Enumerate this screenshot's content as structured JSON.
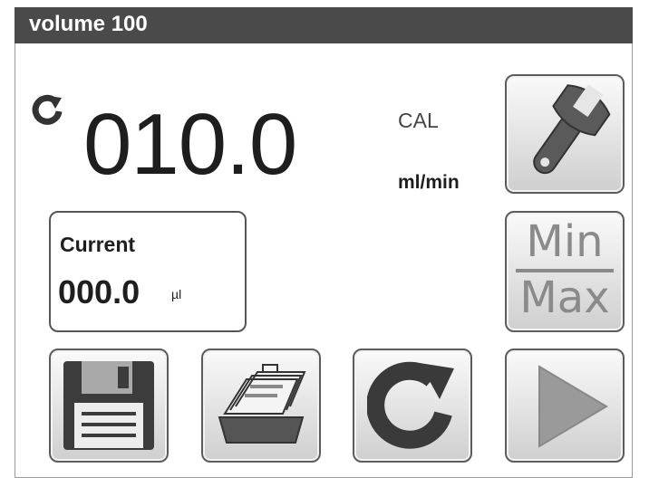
{
  "window": {
    "title": "volume 100"
  },
  "display": {
    "rate_value": "010.0",
    "cal_label": "CAL",
    "rate_unit": "ml/min"
  },
  "current": {
    "label": "Current",
    "value": "000.0",
    "unit": "µl"
  },
  "minmax": {
    "top": "Min",
    "bottom": "Max"
  },
  "icons": [
    "rotation-icon",
    "wrench-icon",
    "floppy-disk-icon",
    "card-file-icon",
    "refresh-icon",
    "play-icon"
  ],
  "colors": {
    "titlebar": "#4a4a4a",
    "text": "#1e1e1e",
    "disabled": "#8a8a8a"
  }
}
